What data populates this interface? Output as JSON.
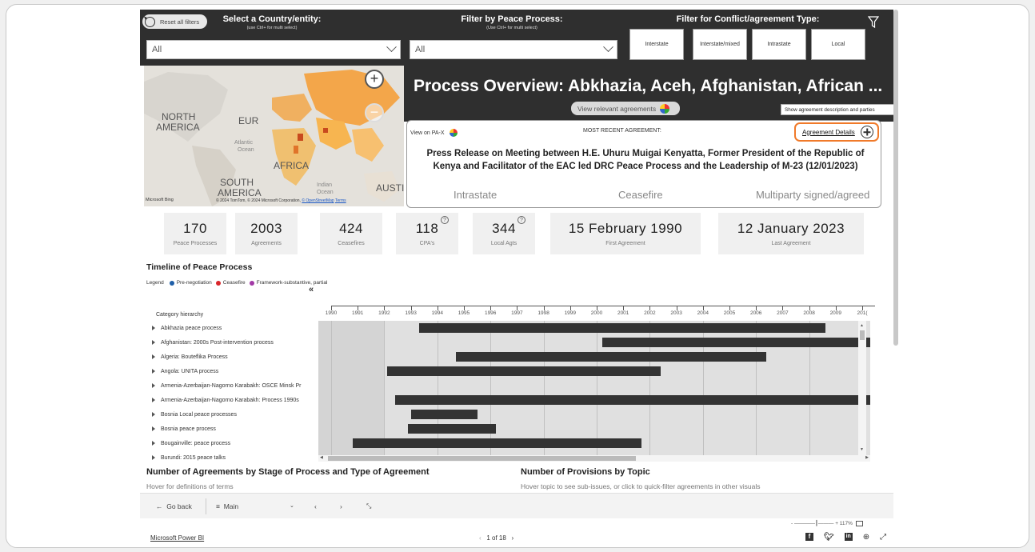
{
  "filters": {
    "reset_label": "Reset all filters",
    "country_label": "Select a Country/entity:",
    "country_hint": "(use Ctrl+ for multi select)",
    "country_value": "All",
    "process_label": "Filter by Peace Process:",
    "process_hint": "(Use Ctrl+ for multi select)",
    "process_value": "All",
    "type_label": "Filter for Conflict/agreement Type:",
    "types": [
      "Interstate",
      "Interstate/mixed",
      "Intrastate",
      "Local"
    ]
  },
  "map": {
    "labels": [
      "NORTH",
      "AMERICA",
      "EUR",
      "Atlantic",
      "Ocean",
      "AFRICA",
      "SOUTH",
      "AMERICA",
      "Indian",
      "Ocean",
      "AUSTI"
    ],
    "zoom_in": "+",
    "zoom_out": "−",
    "bing": "Microsoft Bing",
    "credit": "© 2024 TomTom, © 2024 Microsoft Corporation,",
    "osm": "© OpenStreetMap",
    "terms": "Terms"
  },
  "overview": {
    "title": "Process Overview: Abkhazia, Aceh, Afghanistan, African ...",
    "view_relevant": "View relevant agreements"
  },
  "tooltip": "Show agreement description and parties",
  "recent": {
    "view_pax": "View on PA-X",
    "most_recent": "MOST RECENT AGREEMENT:",
    "details": "Agreement Details",
    "text": "Press Release on Meeting between H.E. Uhuru Muigai Kenyatta, Former President of the Republic of Kenya and Facilitator of the EAC led DRC Peace Process and the Leadership of M-23 (12/01/2023)",
    "type": "Intrastate",
    "stage": "Ceasefire",
    "status": "Multiparty signed/agreed"
  },
  "kpis": [
    {
      "value": "170",
      "label": "Peace Processes"
    },
    {
      "value": "2003",
      "label": "Agreements"
    },
    {
      "value": "424",
      "label": "Ceasefires"
    },
    {
      "value": "118",
      "label": "CPA's"
    },
    {
      "value": "344",
      "label": "Local Agts"
    },
    {
      "value": "15 February 1990",
      "label": "First Agreement"
    },
    {
      "value": "12 January 2023",
      "label": "Last Agreement"
    }
  ],
  "timeline": {
    "title": "Timeline of Peace Process",
    "legend_label": "Legend",
    "legend": [
      {
        "name": "Pre-negotiation",
        "color": "#1f5fa8"
      },
      {
        "name": "Ceasefire",
        "color": "#d9262a"
      },
      {
        "name": "Framework-substantive, partial",
        "color": "#a23aa6"
      }
    ],
    "collapse": "«",
    "category_header": "Category hierarchy",
    "years": [
      "1990",
      "1991",
      "1992",
      "1993",
      "1994",
      "1995",
      "1996",
      "1997",
      "1998",
      "1999",
      "2000",
      "2001",
      "2002",
      "2003",
      "2004",
      "2005",
      "2006",
      "2007",
      "2008",
      "2009",
      "201("
    ],
    "rows": [
      {
        "label": "Abkhazia peace process",
        "start": 1993.3,
        "end": 2008.6
      },
      {
        "label": "Afghanistan: 2000s Post-intervention process",
        "start": 2000.2,
        "end": 2011
      },
      {
        "label": "Algeria: Bouteflika Process",
        "start": 1994.7,
        "end": 2006.4
      },
      {
        "label": "Angola: UNITA process",
        "start": 1992.1,
        "end": 2002.4
      },
      {
        "label": "Armenia-Azerbaijan-Nagorno Karabakh: OSCE Minsk Pr",
        "start": null,
        "end": null
      },
      {
        "label": "Armenia-Azerbaijan-Nagorno Karabakh: Process 1990s",
        "start": 1992.4,
        "end": 2011
      },
      {
        "label": "Bosnia Local peace processes",
        "start": 1993.0,
        "end": 1995.5
      },
      {
        "label": "Bosnia peace process",
        "start": 1992.9,
        "end": 1996.2
      },
      {
        "label": "Bougainville: peace process",
        "start": 1990.8,
        "end": 2001.7
      },
      {
        "label": "Burundi: 2015 peace talks",
        "start": null,
        "end": null
      }
    ]
  },
  "sections": {
    "stage_title": "Number of Agreements by Stage of Process and Type of Agreement",
    "stage_sub": "Hover for definitions of terms",
    "topic_title": "Number of Provisions by Topic",
    "topic_sub": "Hover topic to see sub-issues, or click to quick-filter agreements in other visuals"
  },
  "nav": {
    "back": "Go back",
    "page": "Main",
    "zoom": "117%"
  },
  "footer": {
    "pbi": "Microsoft Power BI",
    "pager": "1 of 18"
  }
}
